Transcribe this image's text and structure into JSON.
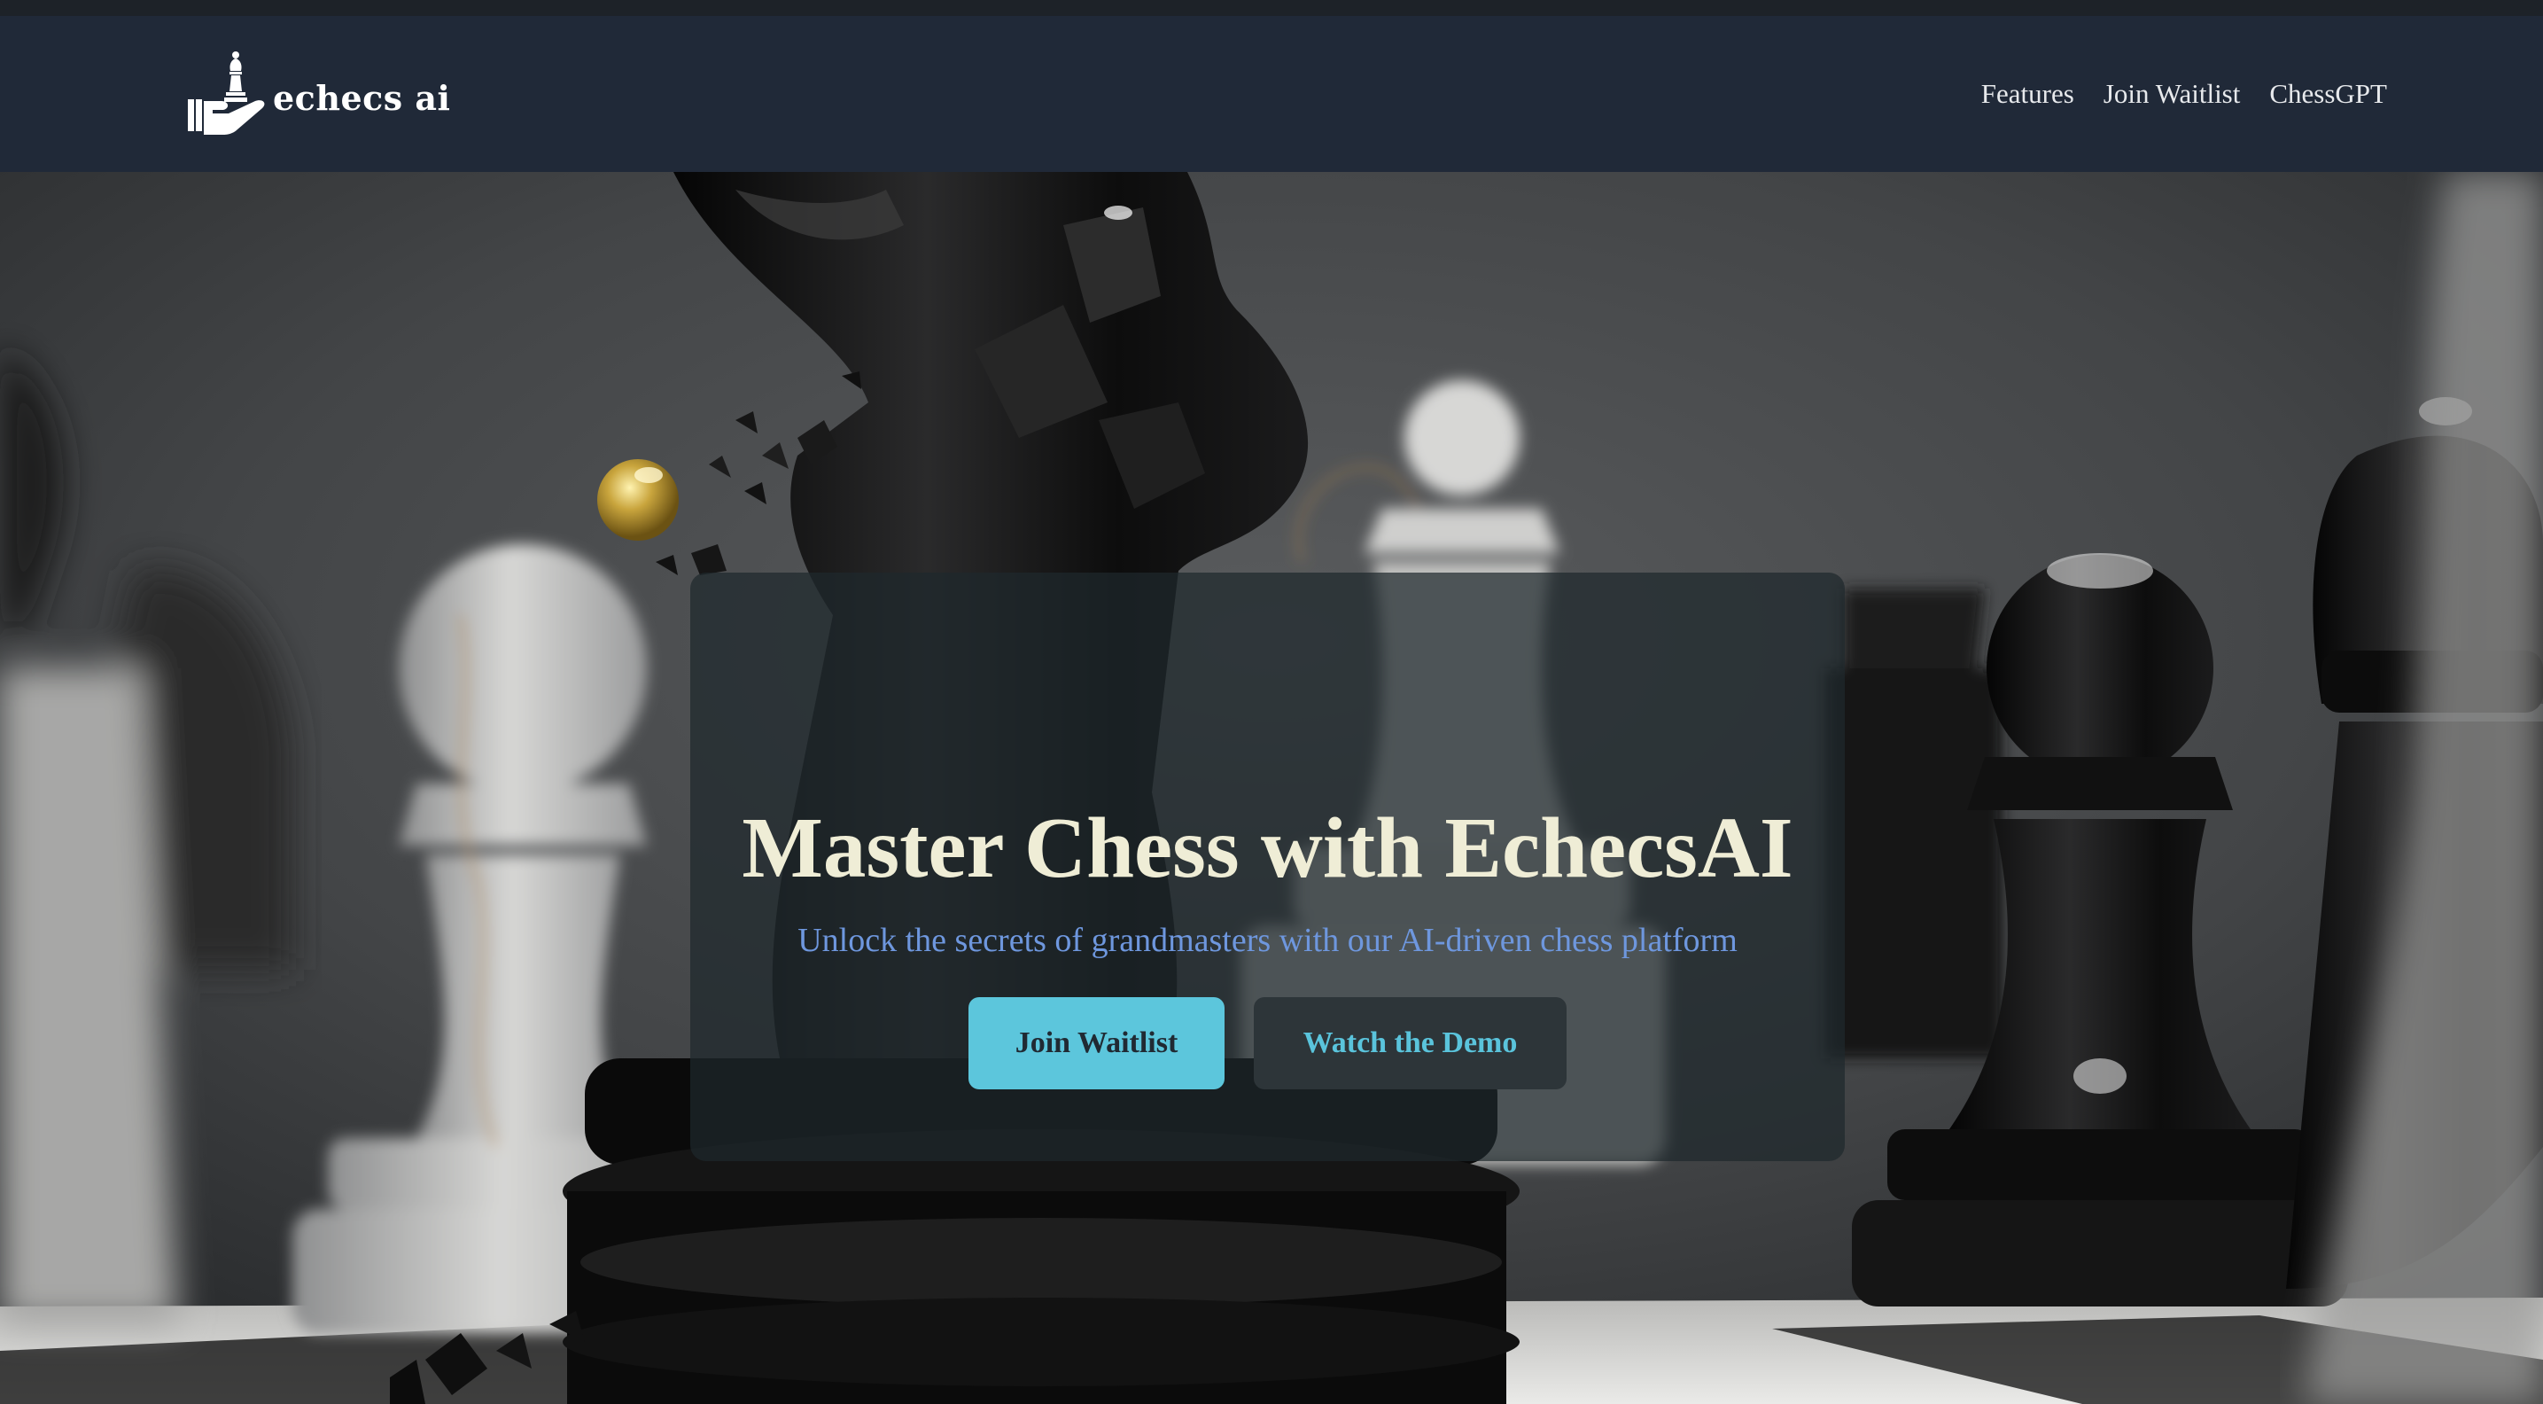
{
  "nav": {
    "brand": "echecs ai",
    "links": [
      "Features",
      "Join Waitlist",
      "ChessGPT"
    ]
  },
  "hero": {
    "title": "Master Chess with EchecsAI",
    "subtitle": "Unlock the secrets of grandmasters with our AI-driven chess platform",
    "primary_button": "Join Waitlist",
    "secondary_button": "Watch the Demo"
  },
  "icons": {
    "logo": "hand-holding-chess-piece-icon"
  },
  "colors": {
    "navbar": "#202938",
    "headline": "#efedd6",
    "subtitle": "#6e97de",
    "accent": "#5cc6dc",
    "card": "rgba(30,40,44,0.72)"
  }
}
